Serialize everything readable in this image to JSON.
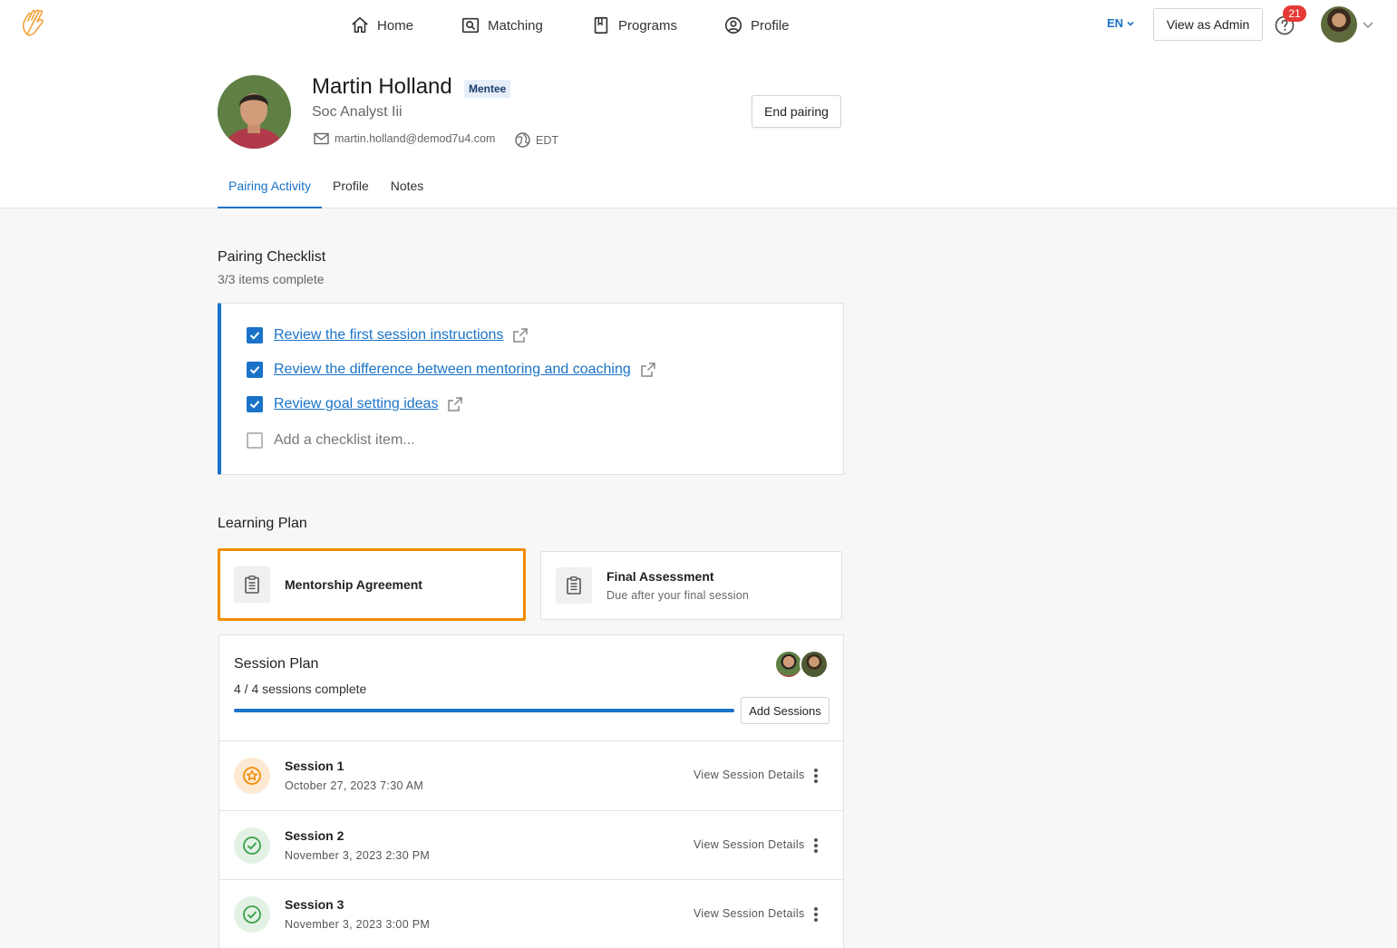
{
  "nav": {
    "home": "Home",
    "matching": "Matching",
    "programs": "Programs",
    "profile": "Profile",
    "language": "EN",
    "view_as_admin": "View as Admin",
    "help_badge_count": "21"
  },
  "profile": {
    "name": "Martin Holland",
    "role_badge": "Mentee",
    "title": "Soc Analyst Iii",
    "email": "martin.holland@demod7u4.com",
    "timezone": "EDT",
    "end_pairing": "End pairing"
  },
  "tabs": [
    "Pairing Activity",
    "Profile",
    "Notes"
  ],
  "checklist": {
    "title": "Pairing Checklist",
    "summary": "3/3 items complete",
    "items": [
      {
        "label": "Review the first session instructions",
        "checked": true
      },
      {
        "label": "Review the difference between mentoring and coaching",
        "checked": true
      },
      {
        "label": "Review goal setting ideas",
        "checked": true
      }
    ],
    "add_placeholder": "Add a checklist item..."
  },
  "learning_plan": {
    "title": "Learning Plan",
    "cards": [
      {
        "name": "Mentorship Agreement",
        "sub": ""
      },
      {
        "name": "Final Assessment",
        "sub": "Due after your final session"
      }
    ]
  },
  "session_plan": {
    "title": "Session Plan",
    "summary": "4 / 4 sessions complete",
    "progress": 1.0,
    "add_sessions": "Add Sessions",
    "view_details": "View Session Details",
    "sessions": [
      {
        "name": "Session 1",
        "date": "October 27, 2023 7:30 AM",
        "status": "star"
      },
      {
        "name": "Session 2",
        "date": "November 3, 2023 2:30 PM",
        "status": "done"
      },
      {
        "name": "Session 3",
        "date": "November 3, 2023 3:00 PM",
        "status": "done"
      }
    ]
  },
  "colors": {
    "accent": "#1a73c8",
    "highlight": "#f28c00",
    "badge": "#e53935",
    "success": "#3aa14a"
  }
}
